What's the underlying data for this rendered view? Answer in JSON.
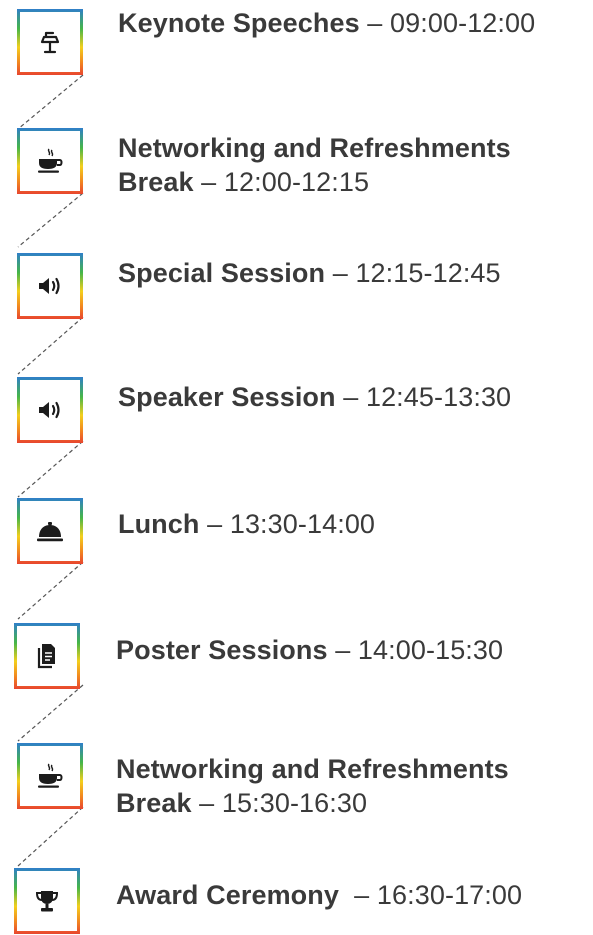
{
  "colors": {
    "text": "#3a3a3a",
    "icon": "#1c1c1c",
    "gradient": [
      "#2f7fc9",
      "#46b648",
      "#f3cf1d",
      "#f28a1e",
      "#e8462f"
    ]
  },
  "agenda": [
    {
      "icon": "podium-icon",
      "name": "Keynote Speeches",
      "separator": " – ",
      "time": "09:00-12:00"
    },
    {
      "icon": "coffee-cup-icon",
      "name": "Networking and Refreshments Break",
      "separator": " – ",
      "time": "12:00-12:15"
    },
    {
      "icon": "speaker-volume-icon",
      "name": "Special Session",
      "separator": " – ",
      "time": "12:15-12:45"
    },
    {
      "icon": "speaker-volume-icon",
      "name": "Speaker Session",
      "separator": " – ",
      "time": "12:45-13:30"
    },
    {
      "icon": "cloche-icon",
      "name": "Lunch",
      "separator": " – ",
      "time": "13:30-14:00"
    },
    {
      "icon": "document-icon",
      "name": "Poster Sessions",
      "separator": " – ",
      "time": "14:00-15:30"
    },
    {
      "icon": "coffee-cup-icon",
      "name": "Networking and Refreshments Break",
      "separator": " – ",
      "time": "15:30-16:30"
    },
    {
      "icon": "trophy-icon",
      "name": "Award Ceremony",
      "separator": "  – ",
      "time": "16:30-17:00"
    }
  ]
}
